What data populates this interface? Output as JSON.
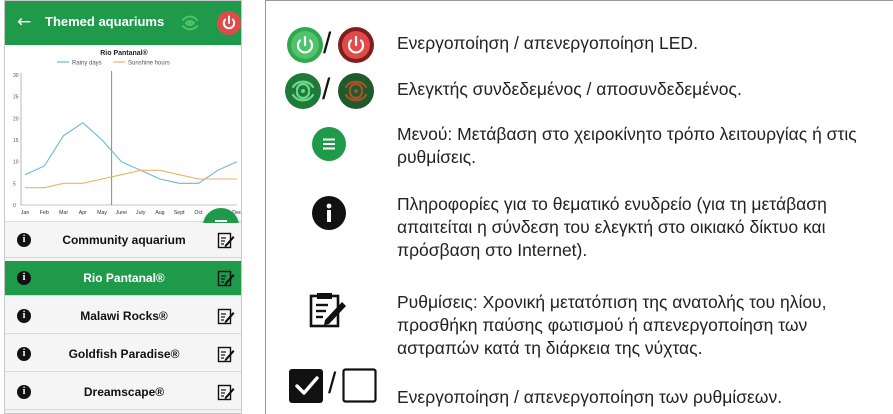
{
  "app": {
    "back_glyph": "←",
    "title": "Themed aquariums",
    "controller_icon": "wifi-controller-icon",
    "power_icon": "power-icon",
    "accent_color": "#1f9a4a",
    "power_color": "#e24a4a"
  },
  "chart_data": {
    "type": "line",
    "title": "Rio Pantanal®",
    "categories": [
      "Jan",
      "Feb",
      "Mar",
      "Apr",
      "May",
      "June",
      "July",
      "Aug",
      "Sept",
      "Oct",
      "Nov",
      "Dec"
    ],
    "series": [
      {
        "name": "Rainy days",
        "color": "#6bb6dd",
        "values": [
          7,
          9,
          16,
          19,
          15,
          10,
          8,
          6,
          5,
          5,
          8,
          10
        ]
      },
      {
        "name": "Sunshine hours",
        "color": "#e8b468",
        "values": [
          4,
          4,
          5,
          5,
          6,
          7,
          8,
          8,
          7,
          6,
          6,
          6
        ]
      }
    ],
    "yticks": [
      "0",
      "5",
      "10",
      "15",
      "20",
      "25",
      "30"
    ],
    "ylim": [
      0,
      30
    ],
    "marker_month": "June",
    "xlabel": "",
    "ylabel": ""
  },
  "aquariums": [
    {
      "name": "Community aquarium",
      "active": false
    },
    {
      "name": "Rio Pantanal®",
      "active": true
    },
    {
      "name": "Malawi Rocks®",
      "active": false
    },
    {
      "name": "Goldfish Paradise®",
      "active": false
    },
    {
      "name": "Dreamscape®",
      "active": false
    }
  ],
  "legend": {
    "slash": "/",
    "led": "Ενεργοποίηση / απενεργοποίηση LED.",
    "controller": "Ελεγκτής συνδεδεμένος / αποσυνδεδεμένος.",
    "menu": "Μενού: Μετάβαση στο χειροκίνητο τρόπο λειτουργίας ή στις ρυθμίσεις.",
    "info": "Πληροφορίες για το θεματικό ενυδρείο (για τη μετάβαση απαιτείται η σύνδεση του ελεγκτή στο οικιακό δίκτυο και πρόσβαση στο Internet).",
    "settings": "Ρυθμίσεις: Χρονική μετατόπιση της ανατολής του ηλίου, προσθήκη παύσης φωτισμού ή απενεργοποίηση των αστραπών κατά τη διάρκεια της νύχτας.",
    "checkbox": "Ενεργοποίηση / απενεργοποίηση των ρυθμίσεων."
  }
}
